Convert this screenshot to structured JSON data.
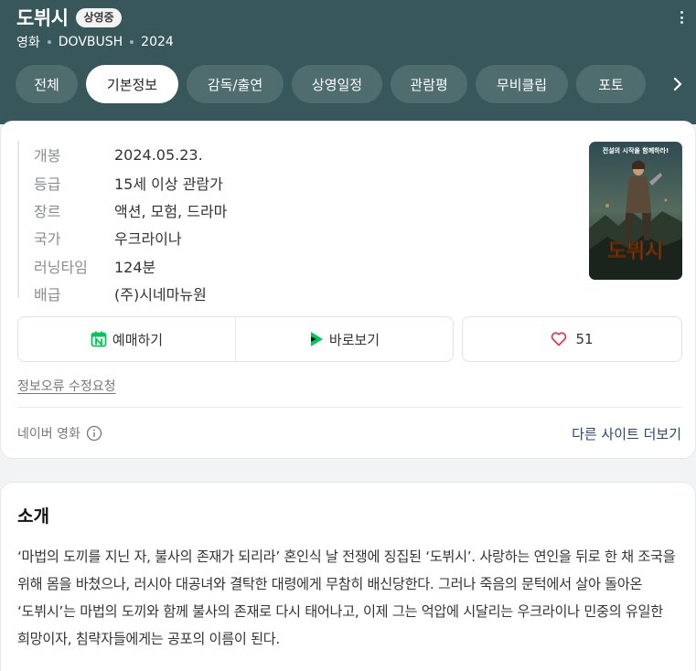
{
  "header": {
    "title": "도뷔시",
    "badge": "상영중",
    "meta": [
      "영화",
      "DOVBUSH",
      "2024"
    ]
  },
  "tabs": [
    {
      "label": "전체",
      "active": false
    },
    {
      "label": "기본정보",
      "active": true
    },
    {
      "label": "감독/출연",
      "active": false
    },
    {
      "label": "상영일정",
      "active": false
    },
    {
      "label": "관람평",
      "active": false
    },
    {
      "label": "무비클립",
      "active": false
    },
    {
      "label": "포토",
      "active": false
    }
  ],
  "info": [
    {
      "label": "개봉",
      "value": "2024.05.23."
    },
    {
      "label": "등급",
      "value": "15세 이상 관람가"
    },
    {
      "label": "장르",
      "value": "액션, 모험, 드라마"
    },
    {
      "label": "국가",
      "value": "우크라이나"
    },
    {
      "label": "러닝타임",
      "value": "124분"
    },
    {
      "label": "배급",
      "value": "(주)시네마뉴원"
    }
  ],
  "poster": {
    "tagline": "전설의 시작을 함께하라!",
    "title": "도뷔시"
  },
  "actions": {
    "reserve_label": "예매하기",
    "watch_label": "바로보기",
    "like_count": "51"
  },
  "edit_link": "정보오류 수정요청",
  "source_label": "네이버 영화",
  "more_sites": "다른 사이트 더보기",
  "intro": {
    "title": "소개",
    "text": "‘마법의 도끼를 지닌 자, 불사의 존재가 되리라’ 혼인식 날 전쟁에 징집된 ‘도뷔시’. 사랑하는 연인을 뒤로 한 채 조국을 위해 몸을 바쳤으나, 러시아 대공녀와 결탁한 대령에게 무참히 배신당한다. 그러나 죽음의 문턱에서 살아 돌아온 ‘도뷔시’는 마법의 도끼와 함께 불사의 존재로 다시 태어나고, 이제 그는 억압에 시달리는 우크라이나 민중의 유일한 희망이자, 침략자들에게는 공포의 이름이 된다."
  },
  "colors": {
    "header_bg": "#37575a",
    "tab_bg": "#4f6d6f",
    "link_blue": "#2c4470",
    "heart": "#e0384a",
    "naver_green": "#03c75a"
  }
}
